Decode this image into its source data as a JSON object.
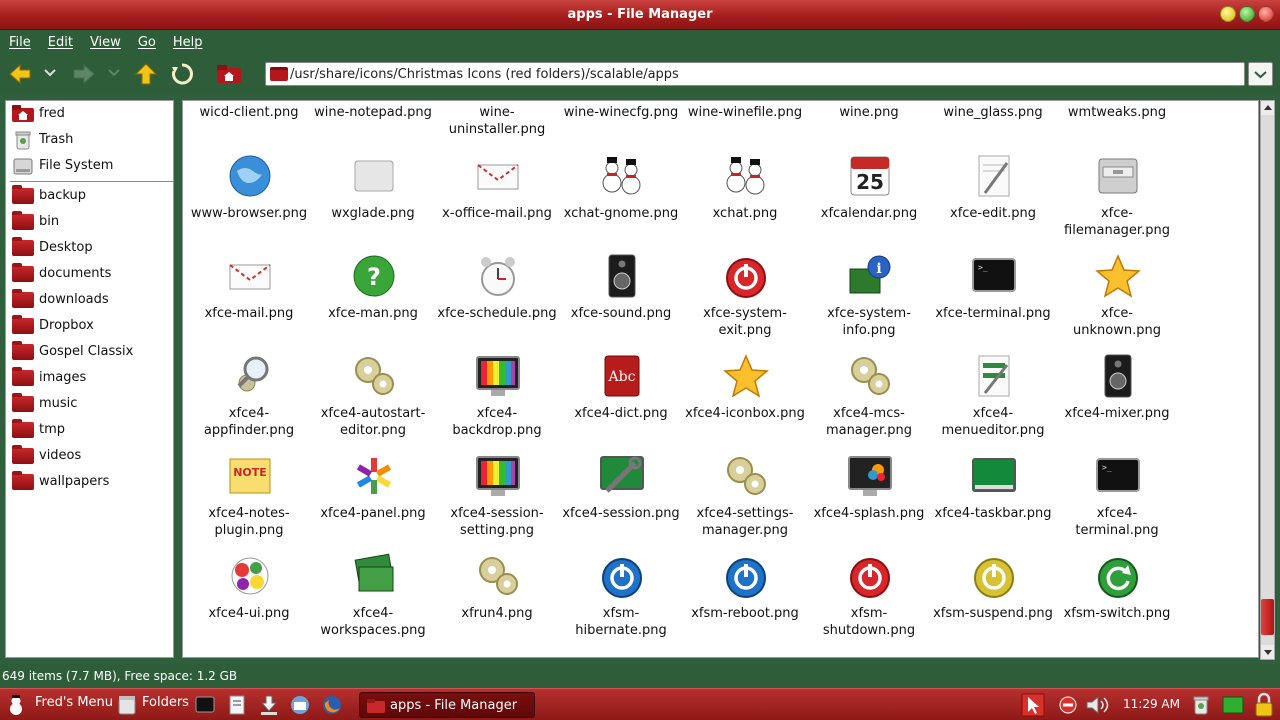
{
  "window": {
    "title": "apps - File Manager"
  },
  "menu": [
    "File",
    "Edit",
    "View",
    "Go",
    "Help"
  ],
  "address": {
    "path": "/usr/share/icons/Christmas Icons (red folders)/scalable/apps"
  },
  "sidebar": {
    "places": [
      {
        "label": "fred",
        "icon": "home-folder-icon"
      },
      {
        "label": "Trash",
        "icon": "trash-icon"
      },
      {
        "label": "File System",
        "icon": "drive-icon"
      }
    ],
    "bookmarks": [
      "backup",
      "bin",
      "Desktop",
      "documents",
      "downloads",
      "Dropbox",
      "Gospel Classix",
      "images",
      "music",
      "tmp",
      "videos",
      "wallpapers"
    ]
  },
  "files": [
    [
      "wicd-client.png",
      "wine-notepad.png",
      "wine-\nuninstaller.png",
      "wine-winecfg.png",
      "wine-winefile.png",
      "wine.png",
      "wine_glass.png",
      "wmtweaks.png"
    ],
    [
      "www-browser.png",
      "wxglade.png",
      "x-office-mail.png",
      "xchat-gnome.png",
      "xchat.png",
      "xfcalendar.png",
      "xfce-edit.png",
      "xfce-\nfilemanager.png"
    ],
    [
      "xfce-mail.png",
      "xfce-man.png",
      "xfce-schedule.png",
      "xfce-sound.png",
      "xfce-system-\nexit.png",
      "xfce-system-\ninfo.png",
      "xfce-terminal.png",
      "xfce-unknown.png"
    ],
    [
      "xfce4-\nappfinder.png",
      "xfce4-autostart-\neditor.png",
      "xfce4-\nbackdrop.png",
      "xfce4-dict.png",
      "xfce4-iconbox.png",
      "xfce4-mcs-\nmanager.png",
      "xfce4-\nmenueditor.png",
      "xfce4-mixer.png"
    ],
    [
      "xfce4-notes-\nplugin.png",
      "xfce4-panel.png",
      "xfce4-session-\nsetting.png",
      "xfce4-session.png",
      "xfce4-settings-\nmanager.png",
      "xfce4-splash.png",
      "xfce4-taskbar.png",
      "xfce4-terminal.png"
    ],
    [
      "xfce4-ui.png",
      "xfce4-\nworkspaces.png",
      "xfrun4.png",
      "xfsm-hibernate.png",
      "xfsm-reboot.png",
      "xfsm-shutdown.png",
      "xfsm-suspend.png",
      "xfsm-switch.png"
    ]
  ],
  "status": {
    "text": "649 items (7.7 MB), Free space: 1.2 GB"
  },
  "taskbar": {
    "menu_label": "Fred's Menu",
    "folders_label": "Folders",
    "task_label": "apps - File Manager",
    "clock": "11:29 AM"
  },
  "colors": {
    "accent": "#a51e1d",
    "chrome": "#2e5d3a"
  }
}
